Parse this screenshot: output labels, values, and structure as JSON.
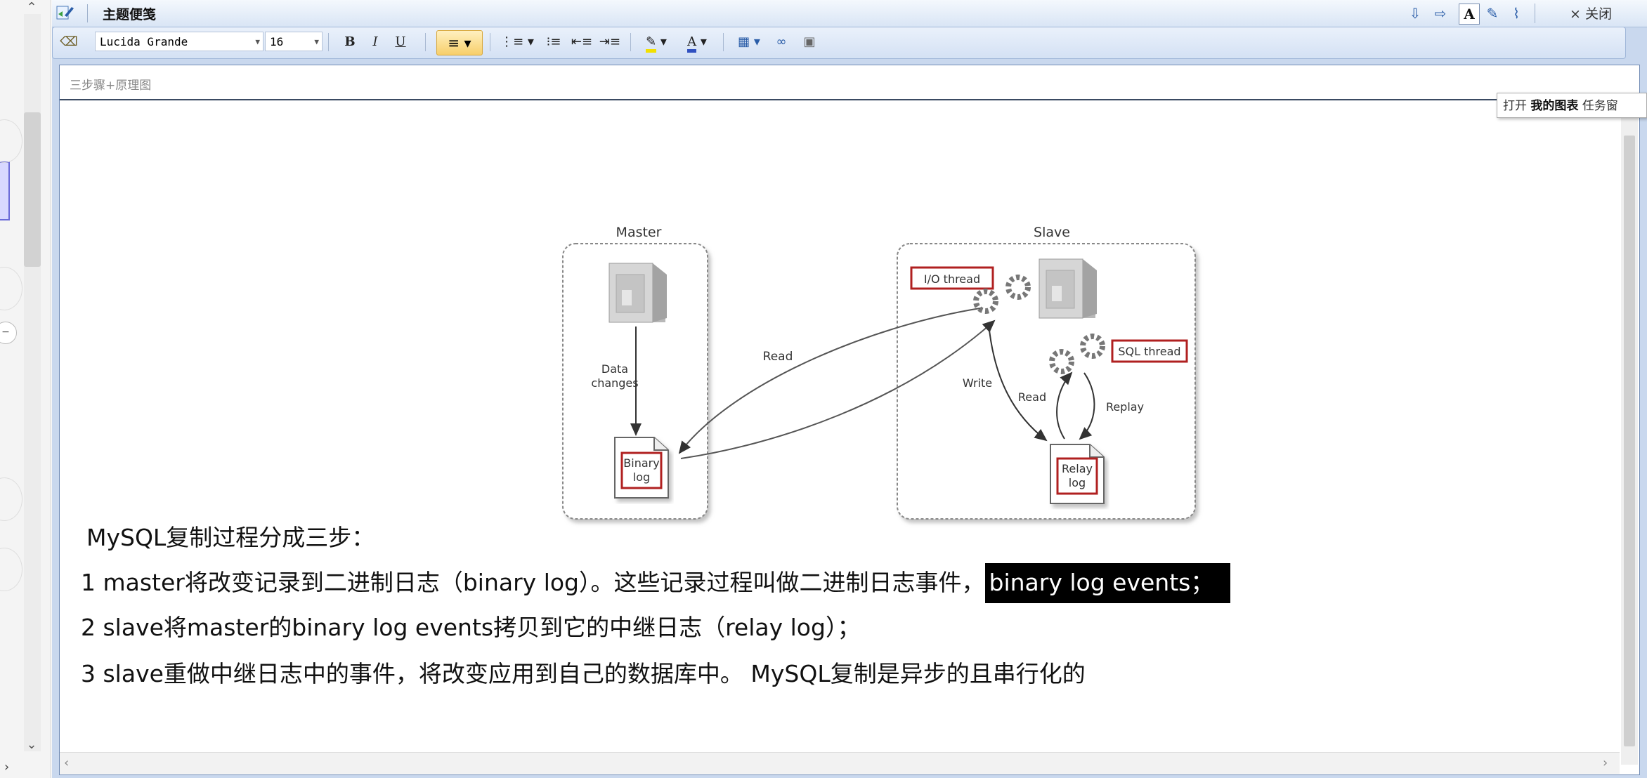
{
  "window": {
    "title": "主题便笺",
    "close_label": "× 关闭"
  },
  "toolbar": {
    "font_family": "Lucida Grande",
    "font_size": "16",
    "bold_label": "B",
    "italic_label": "I",
    "underline_label": "U"
  },
  "document": {
    "title": "三步骤+原理图",
    "tooltip_prefix": "打开",
    "tooltip_bold": "我的图表",
    "tooltip_suffix": "任务窗",
    "lines": {
      "intro": "MySQL复制过程分成三步：",
      "step1_text": "1 master将改变记录到二进制日志（binary log）。这些记录过程叫做二进制日志事件，",
      "step1_highlight": "binary log events；",
      "step2": "2 slave将master的binary log events拷贝到它的中继日志（relay log）；",
      "step3": "3 slave重做中继日志中的事件，将改变应用到自己的数据库中。 MySQL复制是异步的且串行化的"
    }
  },
  "diagram": {
    "master_label": "Master",
    "slave_label": "Slave",
    "data_changes_line1": "Data",
    "data_changes_line2": "changes",
    "binary_log_line1": "Binary",
    "binary_log_line2": "log",
    "read_label": "Read",
    "io_thread_label": "I/O thread",
    "sql_thread_label": "SQL thread",
    "write_label": "Write",
    "read2_label": "Read",
    "replay_label": "Replay",
    "relay_log_line1": "Relay",
    "relay_log_line2": "log"
  }
}
